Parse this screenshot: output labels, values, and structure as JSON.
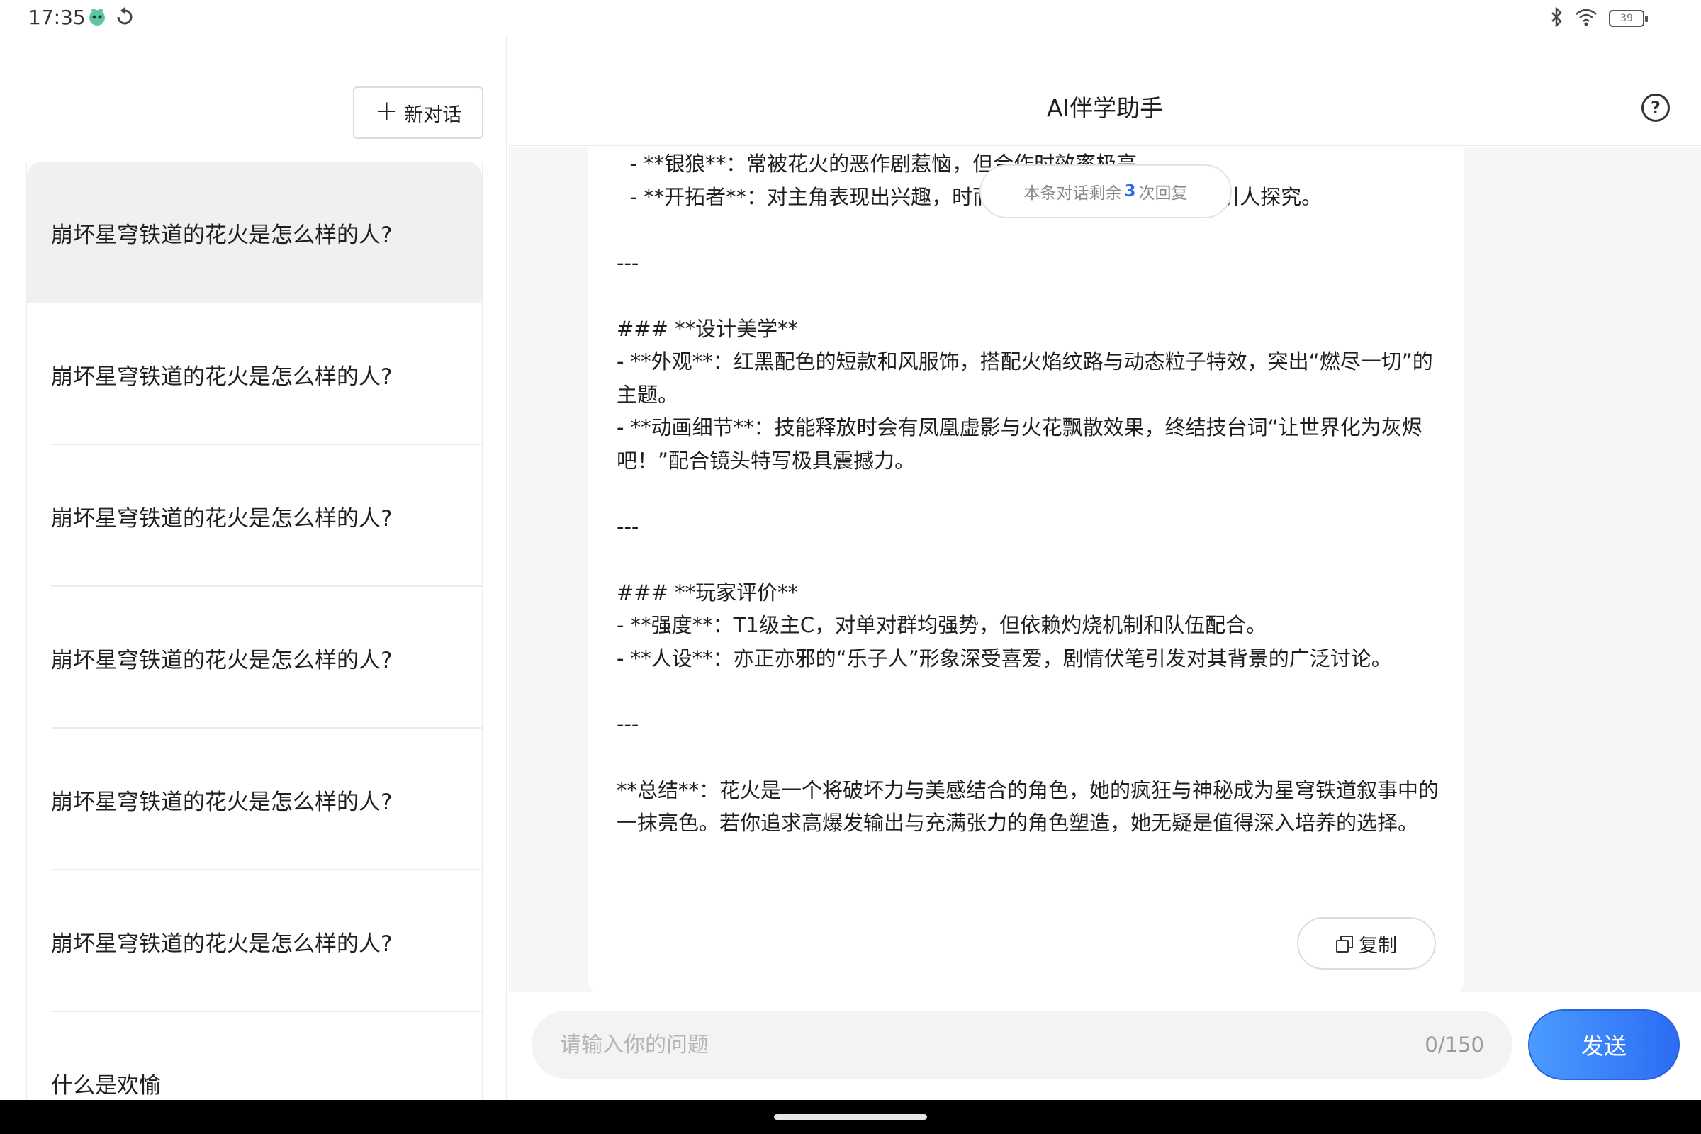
{
  "status_bar": {
    "time": "17:35",
    "battery": "39"
  },
  "sidebar": {
    "new_chat_label": "新对话",
    "conversations": [
      {
        "title": "崩坏星穹铁道的花火是怎么样的人?"
      },
      {
        "title": "崩坏星穹铁道的花火是怎么样的人?"
      },
      {
        "title": "崩坏星穹铁道的花火是怎么样的人?"
      },
      {
        "title": "崩坏星穹铁道的花火是怎么样的人?"
      },
      {
        "title": "崩坏星穹铁道的花火是怎么样的人?"
      },
      {
        "title": "崩坏星穹铁道的花火是怎么样的人?"
      },
      {
        "title": "什么是欢愉"
      }
    ]
  },
  "header": {
    "title": "AI伴学助手"
  },
  "chat": {
    "message": "  - **银狼**：常被花火的恶作剧惹恼，但合作时效率极高。\n  - **开拓者**：对主角表现出兴趣，时而亲近时而疏远，态度模糊引人探究。\n\n---\n\n### **设计美学**\n- **外观**：红黑配色的短款和风服饰，搭配火焰纹路与动态粒子特效，突出“燃尽一切”的主题。\n- **动画细节**：技能释放时会有凤凰虚影与火花飘散效果，终结技台词“让世界化为灰烬吧！”配合镜头特写极具震撼力。\n\n---\n\n### **玩家评价**\n- **强度**：T1级主C，对单对群均强势，但依赖灼烧机制和队伍配合。\n- **人设**：亦正亦邪的“乐子人”形象深受喜爱，剧情伏笔引发对其背景的广泛讨论。\n\n---\n\n**总结**：花火是一个将破坏力与美感结合的角色，她的疯狂与神秘成为星穹铁道叙事中的一抹亮色。若你追求高爆发输出与充满张力的角色塑造，她无疑是值得深入培养的选择。",
    "copy_label": "复制",
    "remaining": {
      "prefix": "本条对话剩余",
      "count": "3",
      "suffix": "次回复"
    }
  },
  "input": {
    "placeholder": "请输入你的问题",
    "counter": "0/150",
    "send_label": "发送"
  },
  "colors": {
    "accent": "#2c6cf4",
    "chat_background": "#f5f6f8",
    "active_item": "#eff0f2"
  },
  "icons": [
    "gecko-icon",
    "refresh-icon",
    "bluetooth-icon",
    "wifi-icon",
    "battery-icon",
    "plus-icon",
    "help-icon",
    "copy-icon"
  ]
}
